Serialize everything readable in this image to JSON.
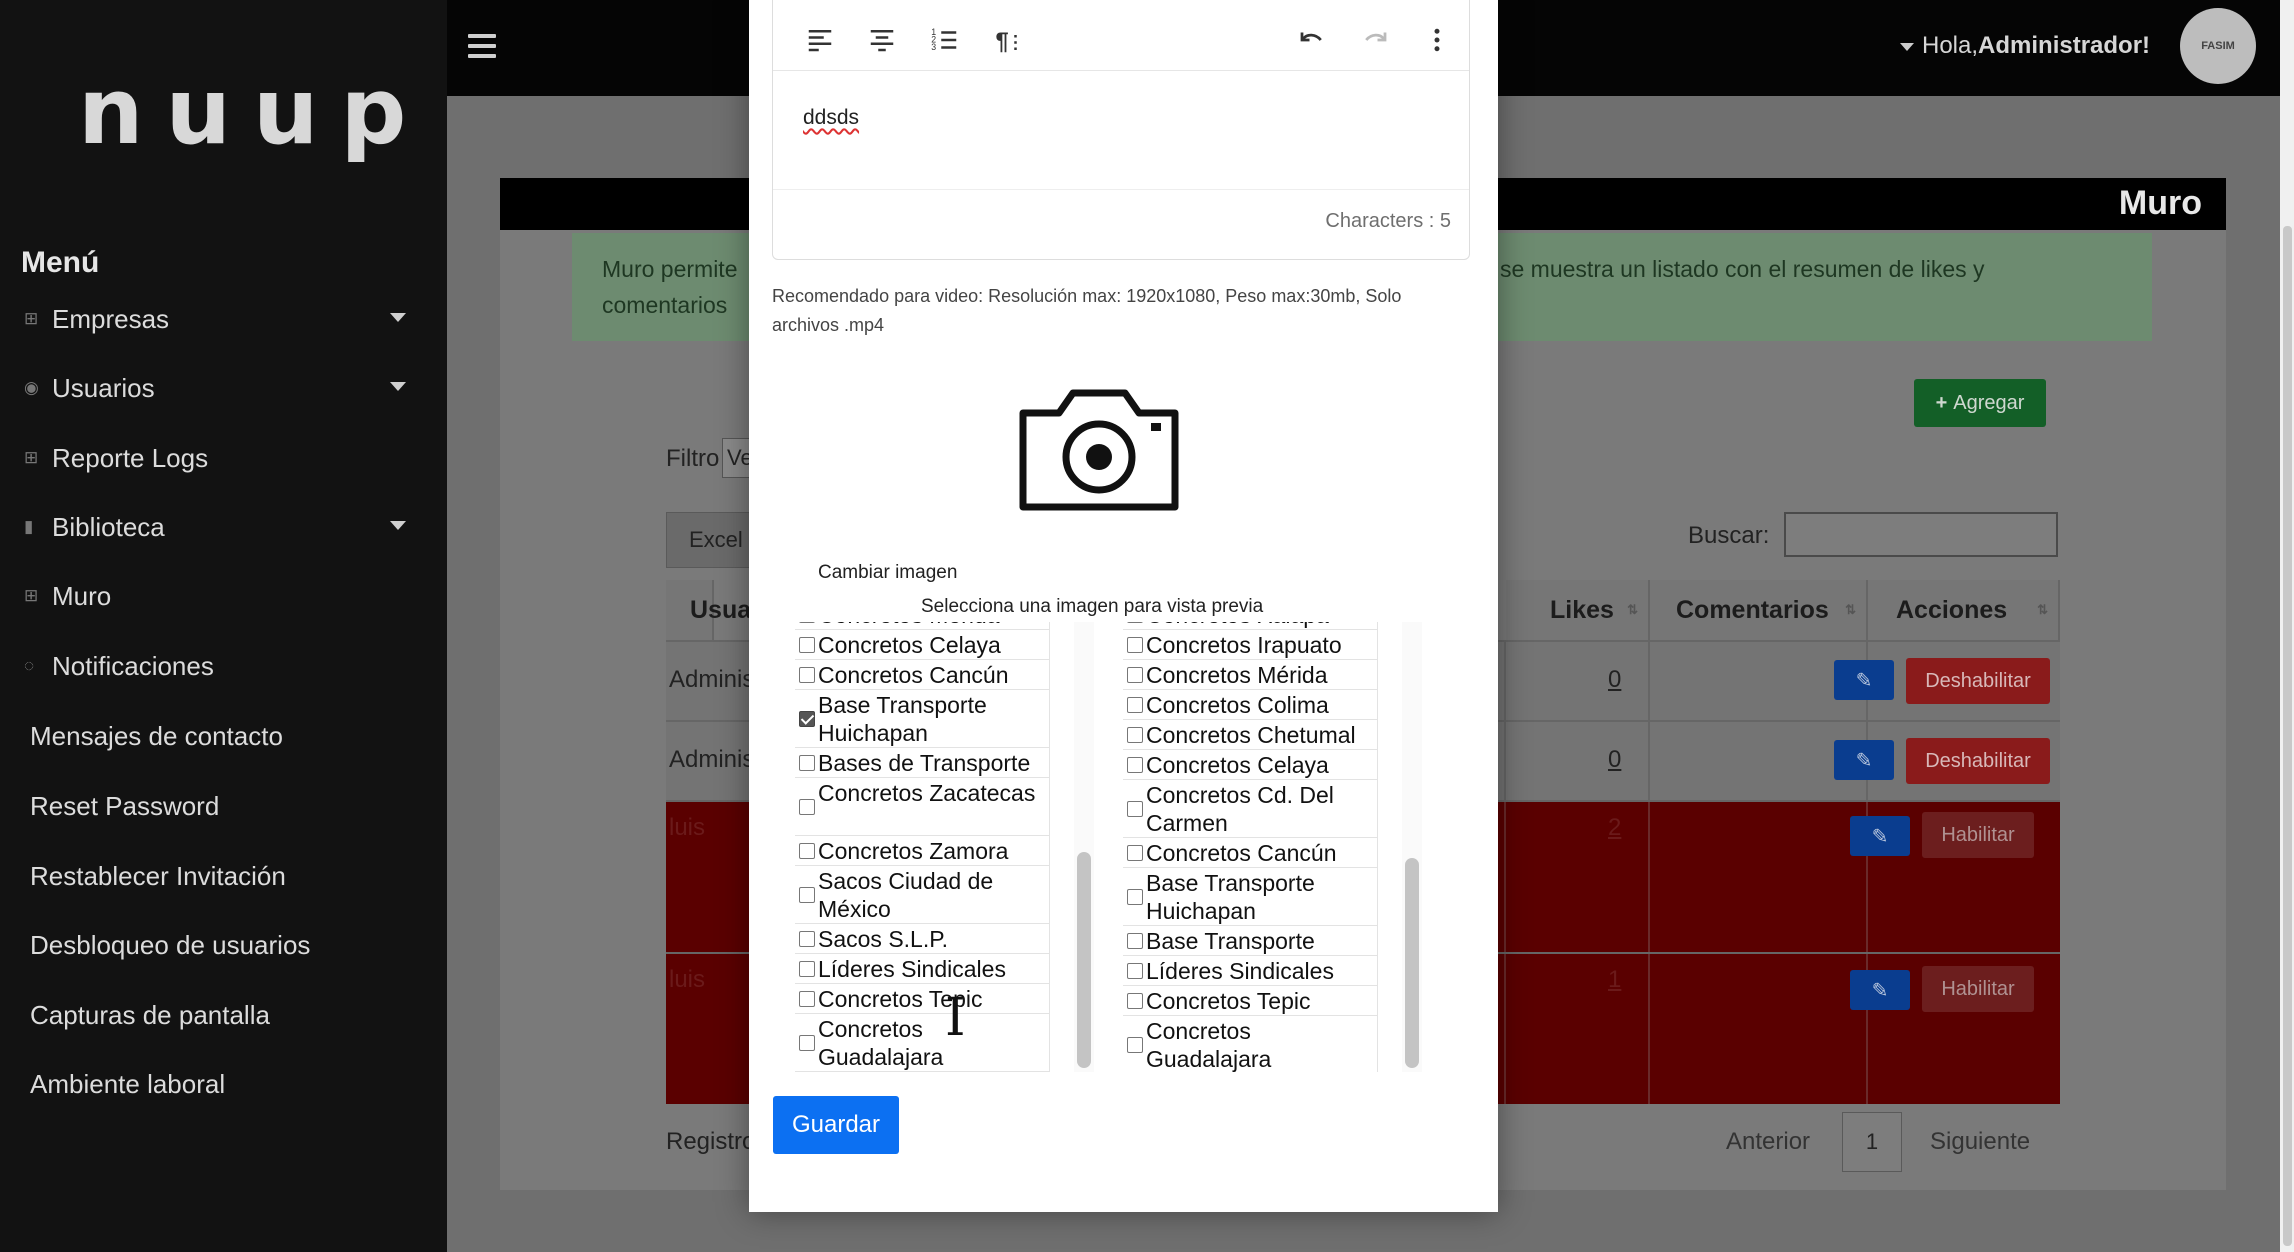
{
  "sidebar": {
    "logo": "nuup",
    "menu_title": "Menú",
    "items": [
      {
        "label": "Empresas",
        "icon": "grid-icon",
        "has_caret": true
      },
      {
        "label": "Usuarios",
        "icon": "user-circle-icon",
        "has_caret": true
      },
      {
        "label": "Reporte Logs",
        "icon": "grid-icon",
        "has_caret": false
      },
      {
        "label": "Biblioteca",
        "icon": "bar-chart-icon",
        "has_caret": true
      },
      {
        "label": "Muro",
        "icon": "grid-icon",
        "has_caret": false
      },
      {
        "label": "Notificaciones",
        "icon": "bell-icon",
        "has_caret": false
      },
      {
        "label": "Mensajes de contacto"
      },
      {
        "label": "Reset Password"
      },
      {
        "label": "Restablecer Invitación"
      },
      {
        "label": "Desbloqueo de usuarios"
      },
      {
        "label": "Capturas de pantalla"
      },
      {
        "label": "Ambiente laboral"
      }
    ]
  },
  "topbar": {
    "greeting_prefix": "Hola,",
    "greeting_name": "Administrador!",
    "avatar_text": "FASIM"
  },
  "page": {
    "title": "Muro",
    "alert_left": "Muro permite",
    "alert_left_2": "comentarios",
    "alert_right": "se muestra un listado con el resumen de likes y",
    "add_button": "Agregar",
    "filtro_label": "Filtro",
    "filtro_value": "Ve",
    "excel_button": "Excel",
    "buscar_label": "Buscar:",
    "table_headers": {
      "usuario": "Usua",
      "likes": "Likes",
      "comentarios": "Comentarios",
      "acciones": "Acciones"
    },
    "rows": [
      {
        "user": "Adminis",
        "comments": "0",
        "action": "Deshabilitar",
        "style": "gray"
      },
      {
        "user": "Adminis",
        "comments": "0",
        "action": "Deshabilitar",
        "style": "gray"
      },
      {
        "user": "luis",
        "comments": "2",
        "action": "Habilitar",
        "style": "red"
      },
      {
        "user": "luis",
        "comments": "1",
        "action": "Habilitar",
        "style": "red"
      }
    ],
    "registros": "Registro",
    "prev": "Anterior",
    "page_number": "1",
    "next": "Siguiente"
  },
  "modal": {
    "editor_text": "ddsds",
    "characters": "Characters : 5",
    "recommendation": "Recomendado para video: Resolución max: 1920x1080, Peso max:30mb, Solo archivos .mp4",
    "change_image": "Cambiar imagen",
    "select_image_hint": "Selecciona una imagen para vista previa",
    "list_left": [
      {
        "label": "Concretos Mérida",
        "checked": false,
        "lines": 1
      },
      {
        "label": "Concretos Celaya",
        "checked": false,
        "lines": 1
      },
      {
        "label": "Concretos Cancún",
        "checked": false,
        "lines": 1
      },
      {
        "label": "Base Transporte Huichapan",
        "checked": true,
        "lines": 2
      },
      {
        "label": "Bases de Transporte",
        "checked": false,
        "lines": 1
      },
      {
        "label": "Concretos Zacatecas",
        "checked": false,
        "lines": 2
      },
      {
        "label": "Concretos Zamora",
        "checked": false,
        "lines": 1
      },
      {
        "label": "Sacos Ciudad de México",
        "checked": false,
        "lines": 2
      },
      {
        "label": "Sacos S.L.P.",
        "checked": false,
        "lines": 1
      },
      {
        "label": "Líderes Sindicales",
        "checked": false,
        "lines": 1
      },
      {
        "label": "Concretos Tepic",
        "checked": false,
        "lines": 1
      },
      {
        "label": "Concretos Guadalajara",
        "checked": false,
        "lines": 2
      }
    ],
    "list_right": [
      {
        "label": "Concretos Xalapa",
        "checked": false,
        "lines": 1
      },
      {
        "label": "Concretos Irapuato",
        "checked": false,
        "lines": 1
      },
      {
        "label": "Concretos Mérida",
        "checked": false,
        "lines": 1
      },
      {
        "label": "Concretos Colima",
        "checked": false,
        "lines": 1
      },
      {
        "label": "Concretos Chetumal",
        "checked": false,
        "lines": 1
      },
      {
        "label": "Concretos Celaya",
        "checked": false,
        "lines": 1
      },
      {
        "label": "Concretos Cd. Del Carmen",
        "checked": false,
        "lines": 2
      },
      {
        "label": "Concretos Cancún",
        "checked": false,
        "lines": 1
      },
      {
        "label": "Base Transporte Huichapan",
        "checked": false,
        "lines": 2
      },
      {
        "label": "Base Transporte",
        "checked": false,
        "lines": 1
      },
      {
        "label": "Líderes Sindicales",
        "checked": false,
        "lines": 1
      },
      {
        "label": "Concretos Tepic",
        "checked": false,
        "lines": 1
      },
      {
        "label": "Concretos Guadalajara",
        "checked": false,
        "lines": 2
      }
    ],
    "save_button": "Guardar"
  }
}
